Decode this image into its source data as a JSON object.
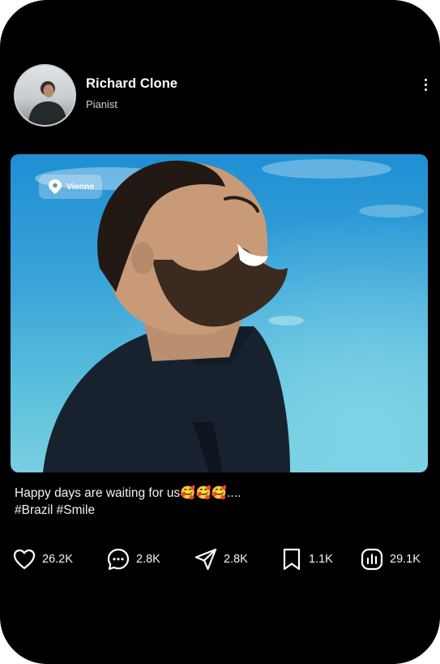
{
  "profile": {
    "name": "Richard Clone",
    "role": "Pianist",
    "avatar_icon": "person-avatar"
  },
  "post": {
    "location": "Vienne",
    "caption_line1": "Happy days are waiting for us🥰🥰🥰....",
    "caption_line2": "#Brazil #Smile"
  },
  "actions": {
    "likes": "26.2K",
    "comments": "2.8K",
    "shares": "2.8K",
    "saves": "1.1K",
    "views": "29.1K"
  },
  "colors": {
    "background": "#000000",
    "text": "#ffffff",
    "sky": "#3aa3d9"
  }
}
